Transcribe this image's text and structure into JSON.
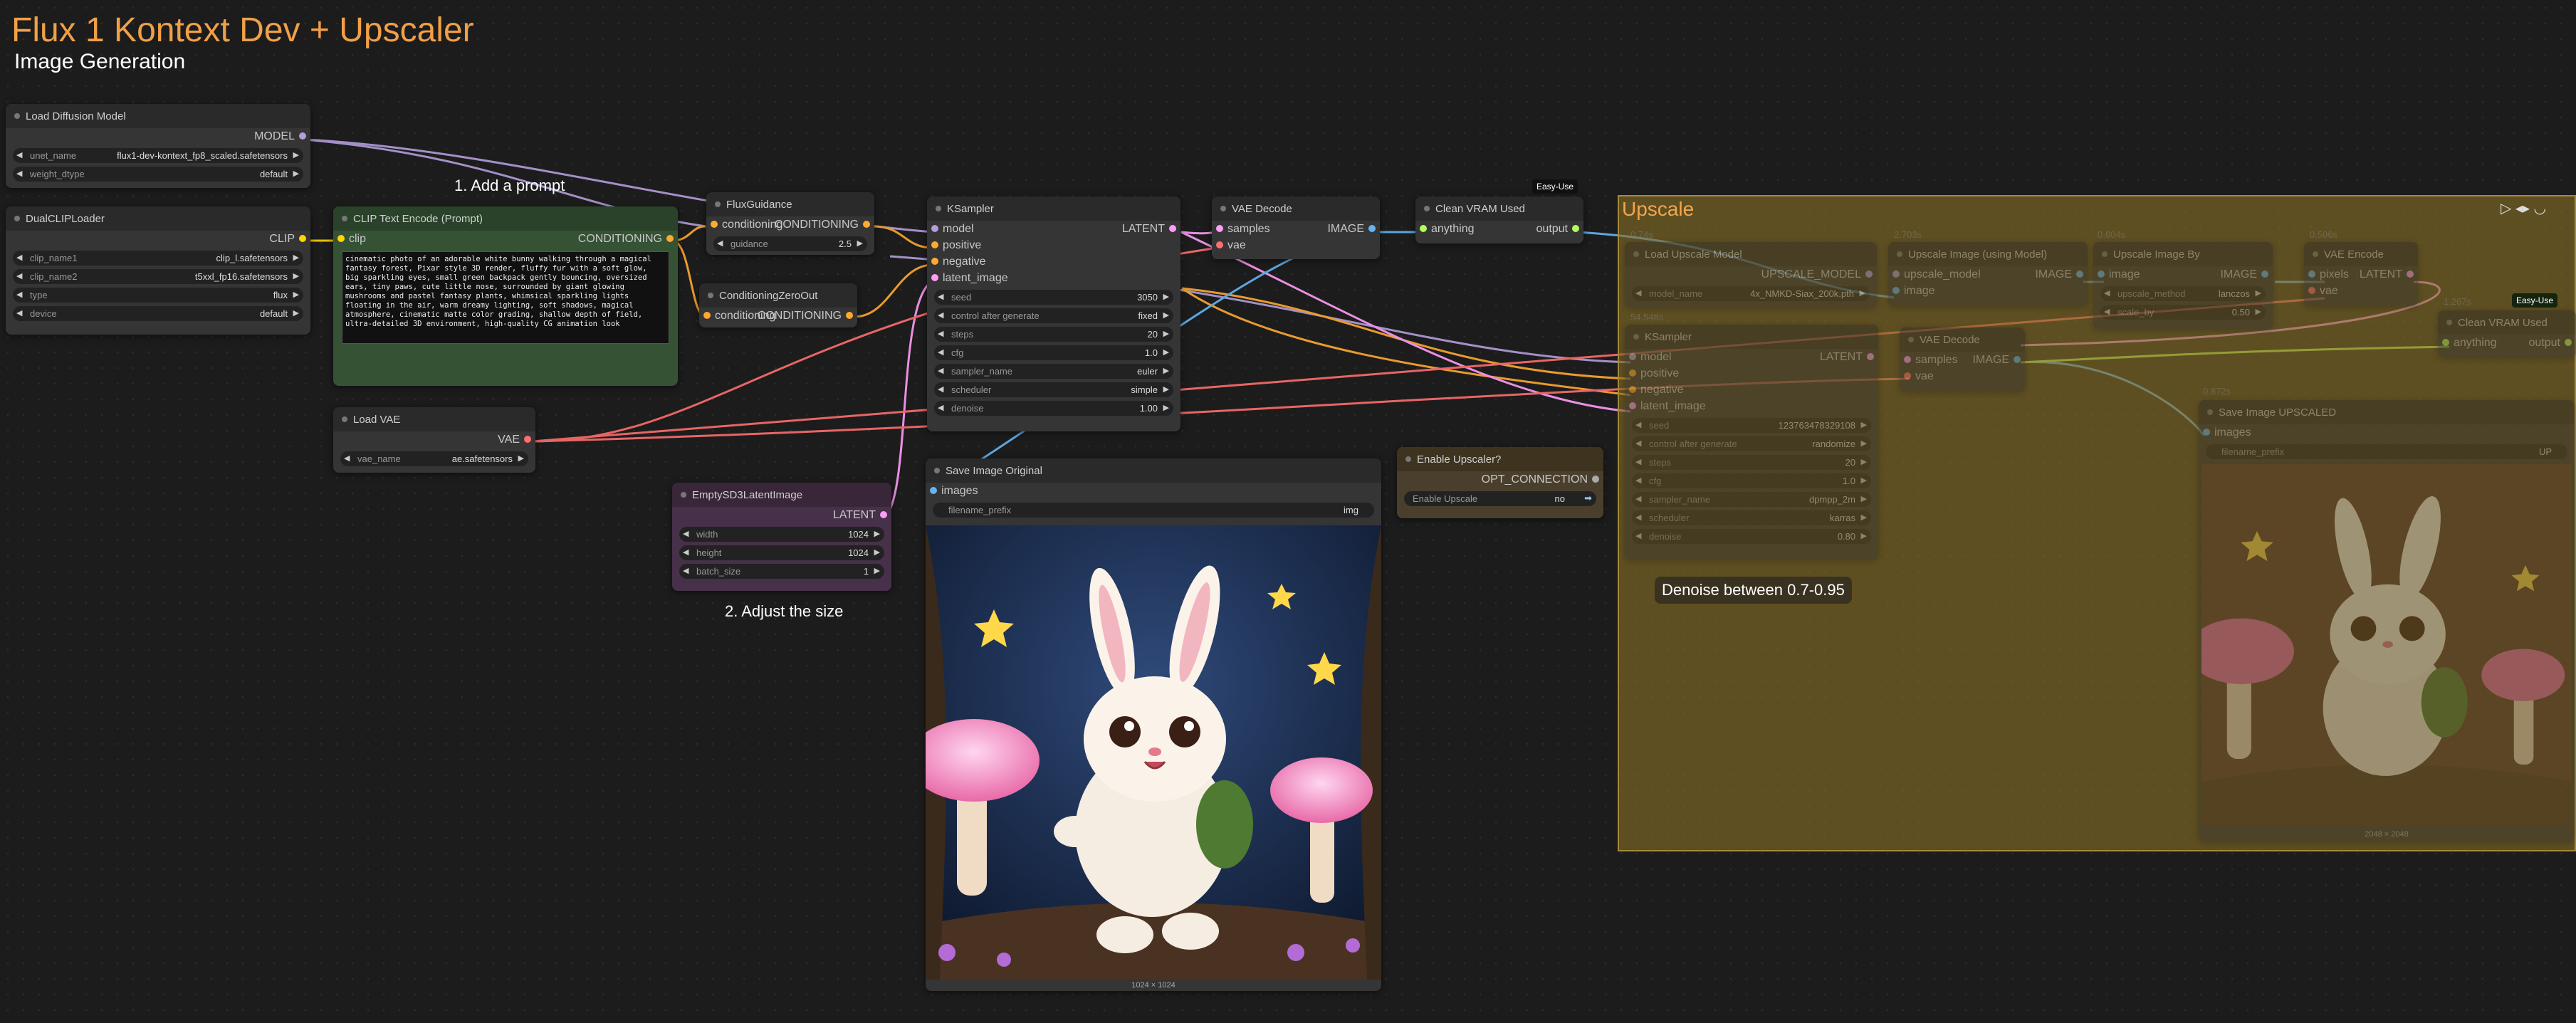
{
  "header": {
    "title": "Flux 1 Kontext Dev + Upscaler",
    "subtitle": "Image Generation"
  },
  "notes": {
    "add_prompt": "1. Add a prompt",
    "adjust_size": "2. Adjust the size",
    "denoise_hint": "Denoise between 0.7-0.95"
  },
  "nodes": {
    "load_diffusion": {
      "title": "Load Diffusion Model",
      "out": "MODEL",
      "unet_label": "unet_name",
      "unet_value": "flux1-dev-kontext_fp8_scaled.safetensors",
      "dtype_label": "weight_dtype",
      "dtype_value": "default"
    },
    "dual_clip": {
      "title": "DualCLIPLoader",
      "out": "CLIP",
      "clip1_label": "clip_name1",
      "clip1_value": "clip_l.safetensors",
      "clip2_label": "clip_name2",
      "clip2_value": "t5xxl_fp16.safetensors",
      "type_label": "type",
      "type_value": "flux",
      "device_label": "device",
      "device_value": "default"
    },
    "clip_text": {
      "title": "CLIP Text Encode (Prompt)",
      "in": "clip",
      "out": "CONDITIONING",
      "prompt": "cinematic photo of an adorable white bunny walking through a magical fantasy forest, Pixar style 3D render, fluffy fur with a soft glow, big sparkling eyes, small green backpack gently bouncing, oversized ears, tiny paws, cute little nose, surrounded by giant glowing mushrooms and pastel fantasy plants, whimsical sparkling lights floating in the air, warm dreamy lighting, soft shadows, magical atmosphere, cinematic matte color grading, shallow depth of field, ultra-detailed 3D environment, high-quality CG animation look"
    },
    "load_vae": {
      "title": "Load VAE",
      "out": "VAE",
      "vae_label": "vae_name",
      "vae_value": "ae.safetensors"
    },
    "empty_latent": {
      "title": "EmptySD3LatentImage",
      "out": "LATENT",
      "width_label": "width",
      "width_value": "1024",
      "height_label": "height",
      "height_value": "1024",
      "batch_label": "batch_size",
      "batch_value": "1"
    },
    "flux_guidance": {
      "title": "FluxGuidance",
      "in": "conditioning",
      "out": "CONDITIONING",
      "guidance_label": "guidance",
      "guidance_value": "2.5"
    },
    "cond_zero": {
      "title": "ConditioningZeroOut",
      "in": "conditioning",
      "out": "CONDITIONING"
    },
    "ksampler": {
      "title": "KSampler",
      "in_model": "model",
      "in_pos": "positive",
      "in_neg": "negative",
      "in_latent": "latent_image",
      "out": "LATENT",
      "seed_label": "seed",
      "seed_value": "3050",
      "cag_label": "control after generate",
      "cag_value": "fixed",
      "steps_label": "steps",
      "steps_value": "20",
      "cfg_label": "cfg",
      "cfg_value": "1.0",
      "sampler_label": "sampler_name",
      "sampler_value": "euler",
      "scheduler_label": "scheduler",
      "scheduler_value": "simple",
      "denoise_label": "denoise",
      "denoise_value": "1.00"
    },
    "vae_decode": {
      "title": "VAE Decode",
      "in_samples": "samples",
      "in_vae": "vae",
      "out": "IMAGE"
    },
    "clean_vram": {
      "title": "Clean VRAM Used",
      "badge": "Easy-Use",
      "in": "anything",
      "out": "output"
    },
    "save_original": {
      "title": "Save Image Original",
      "in": "images",
      "prefix_label": "filename_prefix",
      "prefix_value": "img",
      "dims": "1024 × 1024"
    },
    "enable_upscaler": {
      "title": "Enable Upscaler?",
      "out": "OPT_CONNECTION",
      "toggle_label": "Enable Upscale",
      "toggle_value": "no"
    }
  },
  "group": {
    "title": "Upscale",
    "load_upscale": {
      "title": "Load Upscale Model",
      "time": "0.74s",
      "out": "UPSCALE_MODEL",
      "model_label": "model_name",
      "model_value": "4x_NMKD-Siax_200k.pth"
    },
    "upscale_using": {
      "title": "Upscale Image (using Model)",
      "time": "2.703s",
      "in1": "upscale_model",
      "in2": "image",
      "out": "IMAGE"
    },
    "upscale_by": {
      "title": "Upscale Image By",
      "time": "0.604s",
      "in": "image",
      "out": "IMAGE",
      "method_label": "upscale_method",
      "method_value": "lanczos",
      "scale_label": "scale_by",
      "scale_value": "0.50"
    },
    "vae_encode": {
      "title": "VAE Encode",
      "time": "0.596s",
      "in1": "pixels",
      "in2": "vae",
      "out": "LATENT"
    },
    "ksampler2": {
      "title": "KSampler",
      "time": "54.548s",
      "in_model": "model",
      "in_pos": "positive",
      "in_neg": "negative",
      "in_latent": "latent_image",
      "out": "LATENT",
      "seed_label": "seed",
      "seed_value": "123763478329108",
      "cag_label": "control after generate",
      "cag_value": "randomize",
      "steps_label": "steps",
      "steps_value": "20",
      "cfg_label": "cfg",
      "cfg_value": "1.0",
      "sampler_label": "sampler_name",
      "sampler_value": "dpmpp_2m",
      "scheduler_label": "scheduler",
      "scheduler_value": "karras",
      "denoise_label": "denoise",
      "denoise_value": "0.80"
    },
    "vae_decode2": {
      "title": "VAE Decode",
      "in1": "samples",
      "in2": "vae",
      "out": "IMAGE"
    },
    "clean_vram2": {
      "title": "Clean VRAM Used",
      "badge": "Easy-Use",
      "time": "1.267s",
      "in": "anything",
      "out": "output"
    },
    "save_upscaled": {
      "title": "Save Image UPSCALED",
      "time": "0.872s",
      "in": "images",
      "prefix_label": "filename_prefix",
      "prefix_value": "UP",
      "dims": "2048 × 2048"
    }
  },
  "colors": {
    "model": "#b39ddb",
    "clip": "#ffd500",
    "conditioning": "#ffa931",
    "latent": "#ff9cf9",
    "vae": "#ff6e6e",
    "image": "#64b5f6",
    "any": "#b2ff59"
  }
}
